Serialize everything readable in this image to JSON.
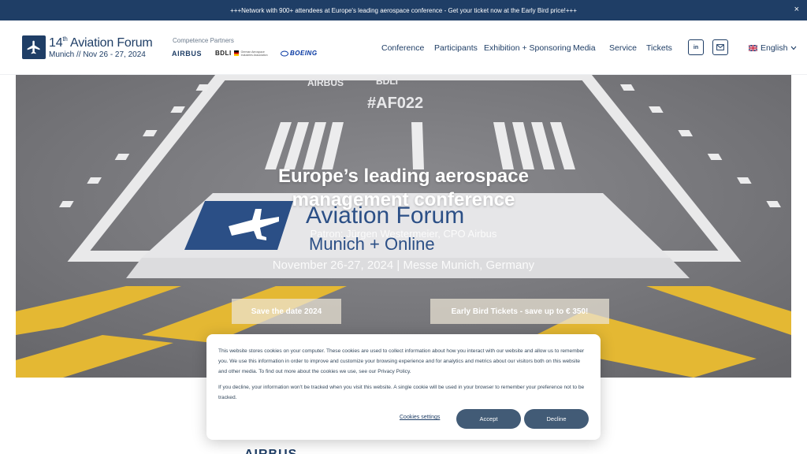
{
  "announcement": {
    "text": "+++Network with 900+ attendees at Europe's leading aerospace conference - Get your ticket now at the Early Bird price!+++",
    "close": "×"
  },
  "header": {
    "logo_title_prefix": "14",
    "logo_title_sup": "th",
    "logo_title_main": " Aviation Forum",
    "logo_subtitle": "Munich // Nov 26 - 27, 2024",
    "partners_label": "Competence Partners",
    "partners": {
      "airbus": "AIRBUS",
      "bdli": "BDLI",
      "bdli_full": "German Aerospace Industries Association",
      "boeing": "BOEING"
    },
    "nav": [
      "Conference",
      "Participants",
      "Exhibition + Sponsoring",
      "Media",
      "Service",
      "Tickets"
    ],
    "social": {
      "linkedin": "in"
    },
    "language": "English"
  },
  "hero": {
    "title_line1": "Europe’s leading aerospace",
    "title_line2": "management conference",
    "patron": "Patron: Jürgen Westermeier, CPO Airbus",
    "date": "November 26-27, 2024 | Messe Munich, Germany",
    "btn_save_date": "Save the date 2024",
    "btn_early_bird": "Early Bird Tickets - save up to € 350!",
    "floor_hashtag": "#AF022",
    "floor_airbus": "AIRBUS",
    "floor_bdli": "BDLI",
    "floor_title": "Aviation Forum",
    "floor_sub": "Munich + Online"
  },
  "below": {
    "logo_text": "AIRBUS"
  },
  "cookie": {
    "p1": "This website stores cookies on your computer. These cookies are used to collect information about how you interact with our website and allow us to remember you. We use this information in order to improve and customize your browsing experience and for analytics and metrics about our visitors both on this website and other media. To find out more about the cookies we use, see our Privacy Policy.",
    "p2": "If you decline, your information won't be tracked when you visit this website. A single cookie will be used in your browser to remember your preference not to be tracked.",
    "settings": "Cookies settings",
    "accept": "Accept",
    "decline": "Decline"
  },
  "colors": {
    "brand_navy": "#1f3e66",
    "cookie_button": "#425b76",
    "tarmac": "#76767a",
    "marking_yellow": "#e4b833"
  },
  "icons": [
    "close-icon",
    "airplane-icon",
    "linkedin-icon",
    "mail-icon",
    "uk-flag-icon",
    "chevron-down-icon"
  ]
}
